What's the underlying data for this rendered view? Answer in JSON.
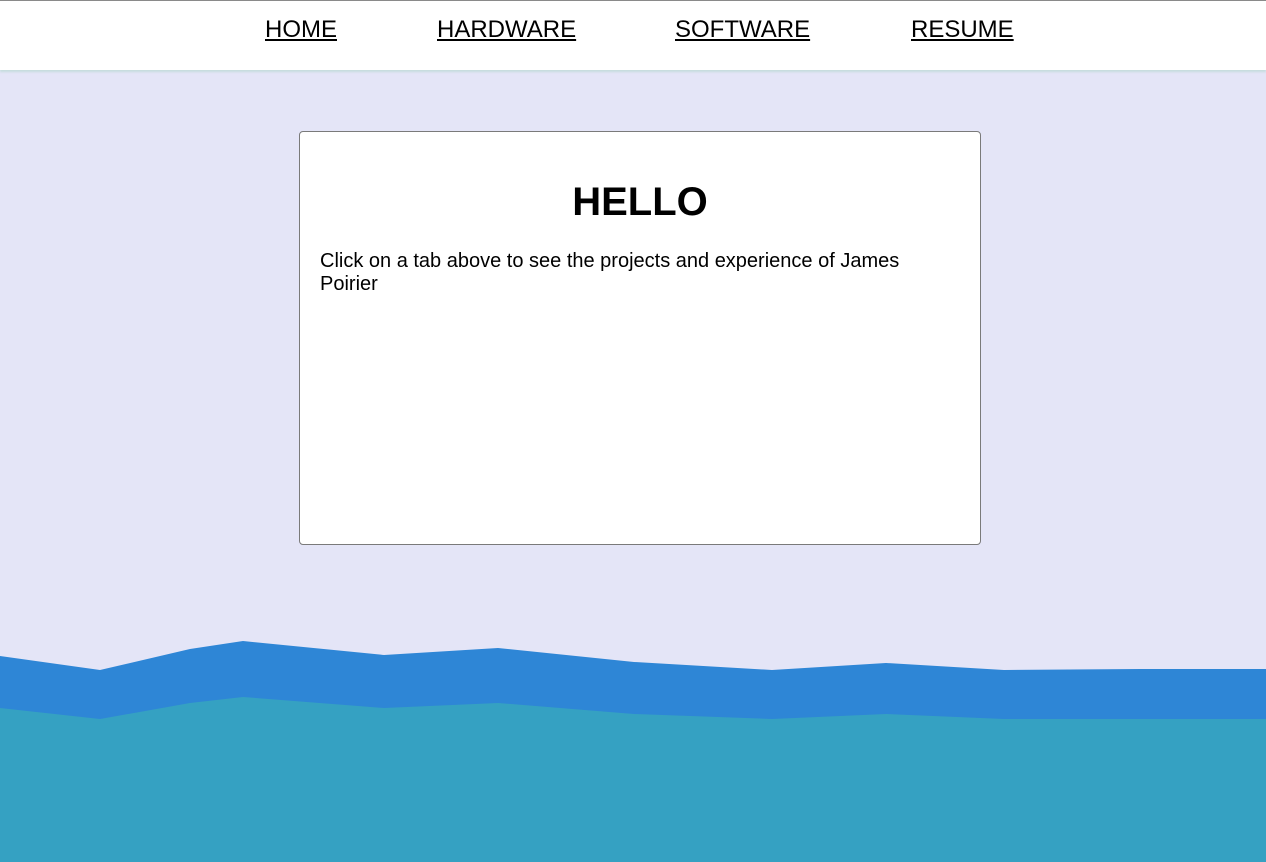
{
  "nav": {
    "items": [
      {
        "label": "HOME"
      },
      {
        "label": "HARDWARE"
      },
      {
        "label": "SOFTWARE"
      },
      {
        "label": "RESUME"
      }
    ]
  },
  "card": {
    "title": "HELLO",
    "body": "Click on a tab above to see the projects and experience of James Poirier"
  },
  "colors": {
    "page_background": "#e4e5f7",
    "wave_back": "#2e86d6",
    "wave_front": "#35a1c2",
    "nav_background": "#ffffff"
  }
}
